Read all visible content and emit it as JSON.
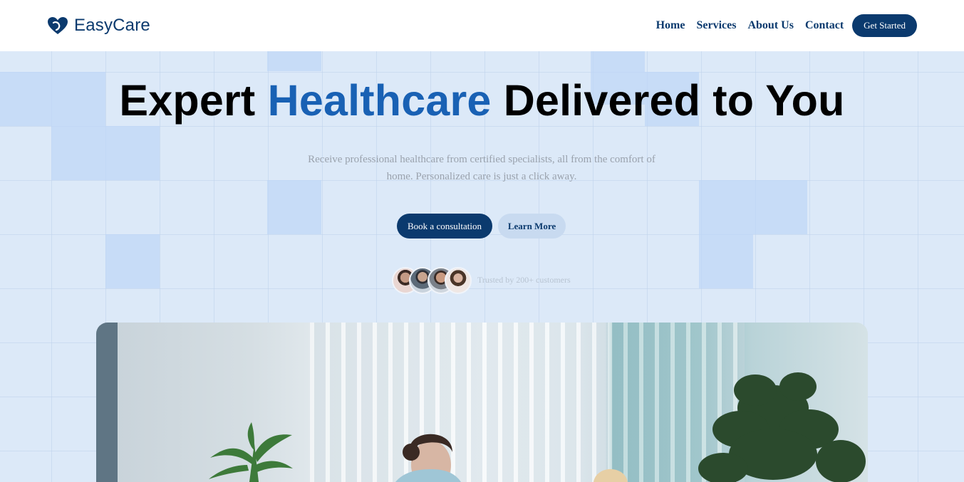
{
  "brand": {
    "name": "EasyCare",
    "icon": "heart-logo-icon"
  },
  "nav": {
    "items": [
      "Home",
      "Services",
      "About Us",
      "Contact"
    ],
    "cta": "Get Started"
  },
  "hero": {
    "title_part1": "Expert ",
    "title_accent": "Healthcare",
    "title_part2": " Delivered to You",
    "subtitle": "Receive professional healthcare from certified specialists, all from the comfort of home. Personalized care is just a click away.",
    "primary_button": "Book a consultation",
    "secondary_button": "Learn More",
    "trusted_text": "Trusted by 200+ customers"
  },
  "colors": {
    "brand": "#0b3a6e",
    "accent": "#1961b4",
    "background": "#dce9f8"
  }
}
